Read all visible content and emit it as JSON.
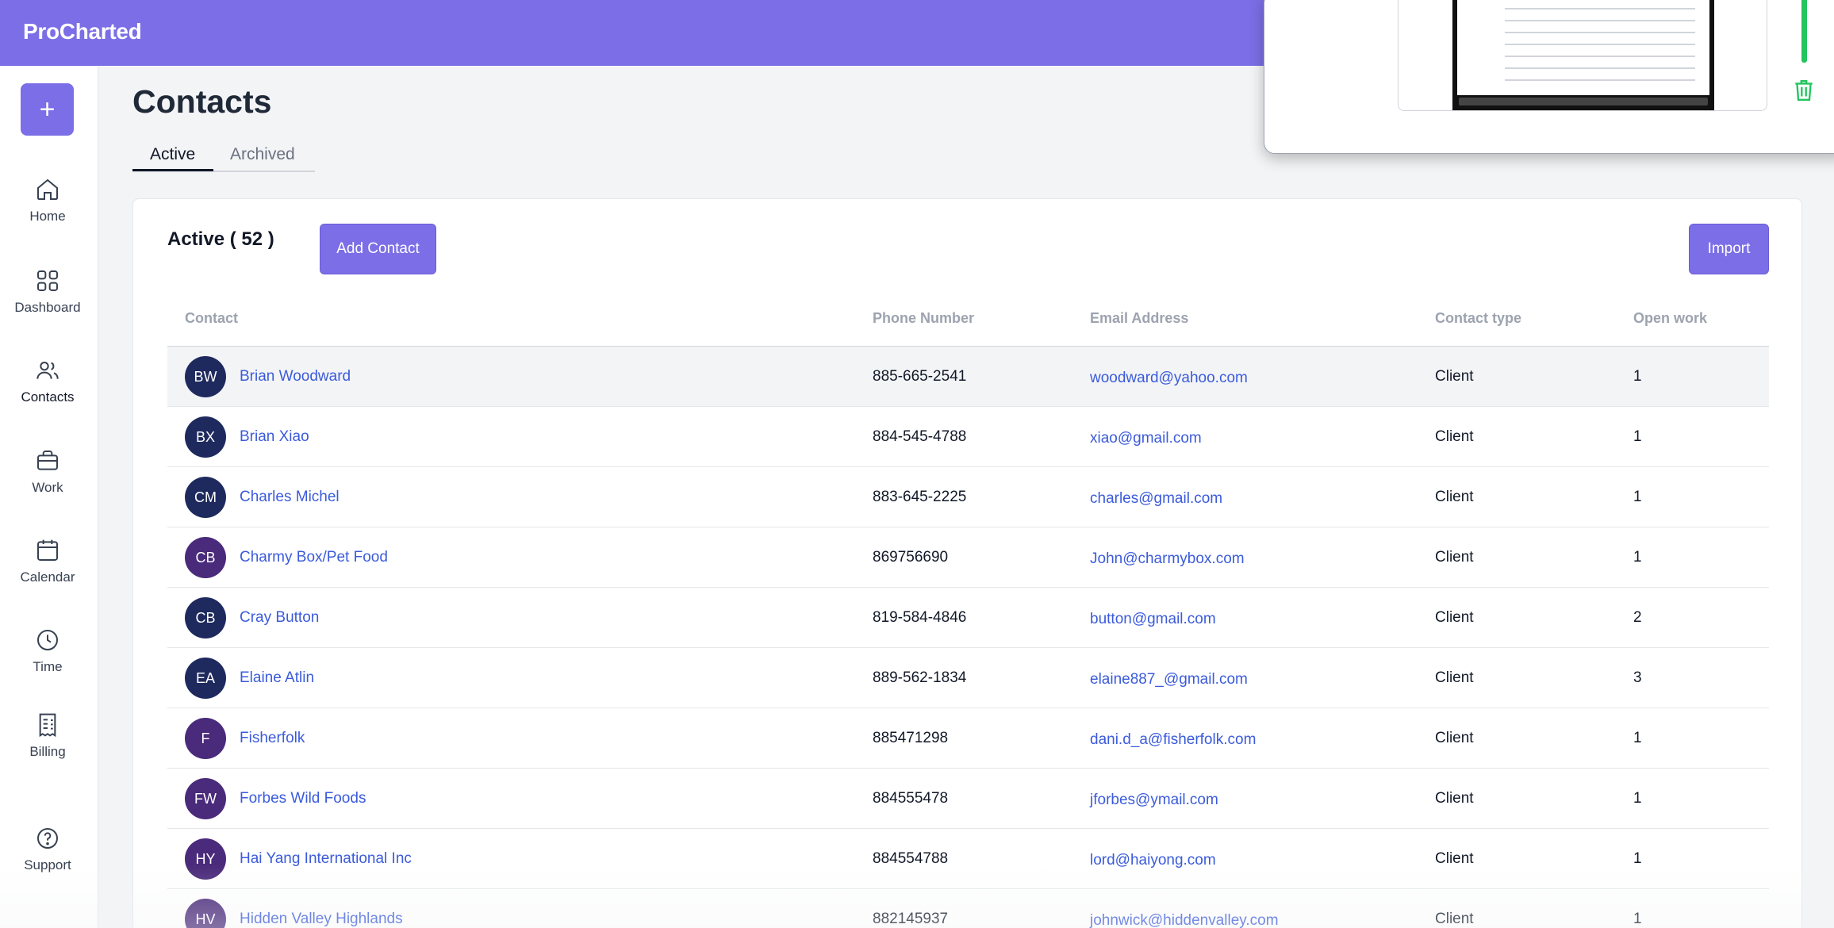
{
  "app": {
    "brand": "ProCharted"
  },
  "sidebar": {
    "new_button_label": "+",
    "items": [
      {
        "label": "Home",
        "icon": "home-icon"
      },
      {
        "label": "Dashboard",
        "icon": "grid-icon"
      },
      {
        "label": "Contacts",
        "icon": "users-icon"
      },
      {
        "label": "Work",
        "icon": "briefcase-icon"
      },
      {
        "label": "Calendar",
        "icon": "calendar-icon"
      },
      {
        "label": "Time",
        "icon": "clock-icon"
      },
      {
        "label": "Billing",
        "icon": "receipt-icon"
      },
      {
        "label": "Support",
        "icon": "help-circle-icon"
      }
    ],
    "active_item": "Contacts"
  },
  "page": {
    "title": "Contacts",
    "tabs": [
      {
        "label": "Active"
      },
      {
        "label": "Archived"
      }
    ],
    "active_tab": "Active"
  },
  "card": {
    "title": "Active ( 52 )",
    "add_button": "Add Contact",
    "import_button": "Import"
  },
  "table": {
    "columns": [
      "Contact",
      "Phone Number",
      "Email Address",
      "Contact type",
      "Open work"
    ],
    "rows": [
      {
        "initials": "BW",
        "name": "Brian Woodward",
        "phone": "885-665-2541",
        "email": "woodward@yahoo.com",
        "type": "Client",
        "open": "1",
        "avatar_color": "#1e2a5e"
      },
      {
        "initials": "BX",
        "name": "Brian Xiao",
        "phone": "884-545-4788",
        "email": "xiao@gmail.com",
        "type": "Client",
        "open": "1",
        "avatar_color": "#1e2a5e"
      },
      {
        "initials": "CM",
        "name": "Charles Michel",
        "phone": "883-645-2225",
        "email": "charles@gmail.com",
        "type": "Client",
        "open": "1",
        "avatar_color": "#1e2a5e"
      },
      {
        "initials": "CB",
        "name": "Charmy Box/Pet Food",
        "phone": "869756690",
        "email": "John@charmybox.com",
        "type": "Client",
        "open": "1",
        "avatar_color": "#4a2a7a"
      },
      {
        "initials": "CB",
        "name": "Cray Button",
        "phone": "819-584-4846",
        "email": "button@gmail.com",
        "type": "Client",
        "open": "2",
        "avatar_color": "#1e2a5e"
      },
      {
        "initials": "EA",
        "name": "Elaine Atlin",
        "phone": "889-562-1834",
        "email": "elaine887_@gmail.com",
        "type": "Client",
        "open": "3",
        "avatar_color": "#1e2a5e"
      },
      {
        "initials": "F",
        "name": "Fisherfolk",
        "phone": "885471298",
        "email": "dani.d_a@fisherfolk.com",
        "type": "Client",
        "open": "1",
        "avatar_color": "#4a2a7a"
      },
      {
        "initials": "FW",
        "name": "Forbes Wild Foods",
        "phone": "884555478",
        "email": "jforbes@ymail.com",
        "type": "Client",
        "open": "1",
        "avatar_color": "#4a2a7a"
      },
      {
        "initials": "HY",
        "name": "Hai Yang International Inc",
        "phone": "884554788",
        "email": "lord@haiyong.com",
        "type": "Client",
        "open": "1",
        "avatar_color": "#4a2a7a"
      },
      {
        "initials": "HV",
        "name": "Hidden Valley Highlands",
        "phone": "882145937",
        "email": "johnwick@hiddenvalley.com",
        "type": "Client",
        "open": "1",
        "avatar_color": "#4a2a7a"
      }
    ]
  },
  "colors": {
    "accent": "#7b6ee6",
    "link": "#3b5bdb"
  },
  "overlay": {
    "icons": [
      "screenshot-thumbnail",
      "trash-icon"
    ]
  }
}
